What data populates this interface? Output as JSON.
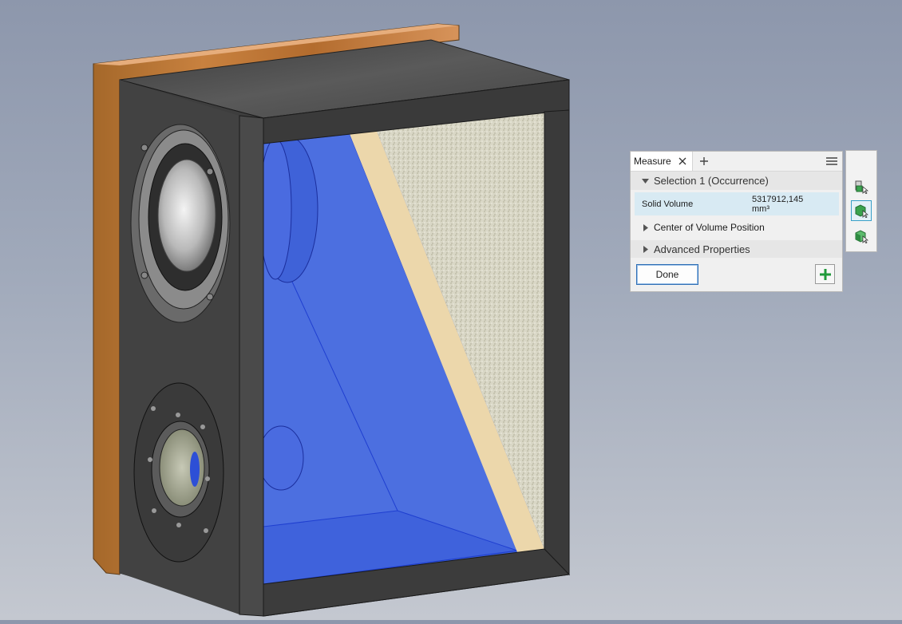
{
  "measure_panel": {
    "tab_label": "Measure",
    "close_icon": "close-icon",
    "add_tab_icon": "plus-icon",
    "menu_icon": "hamburger-menu-icon",
    "selection_header": "Selection 1 (Occurrence)",
    "rows": [
      {
        "label": "Solid Volume",
        "value_line1": "5317912,145",
        "value_line2": "mm³"
      }
    ],
    "center_of_volume_label": "Center of Volume Position",
    "advanced_properties_label": "Advanced Properties",
    "done_label": "Done",
    "add_icon": "green-plus-icon",
    "highlight_color": "#d8eaf3"
  },
  "selection_filters": [
    {
      "icon": "select-component-icon",
      "active": false
    },
    {
      "icon": "select-part-icon",
      "active": true
    },
    {
      "icon": "select-body-icon",
      "active": false
    }
  ],
  "scene": {
    "object": "speaker-cabinet-cutaway",
    "highlight_color": "#4c6fe0"
  }
}
